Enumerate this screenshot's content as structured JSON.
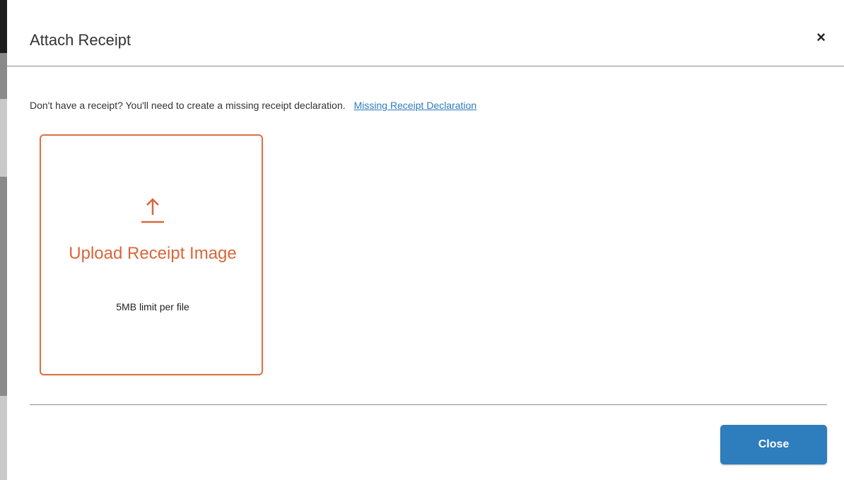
{
  "modal": {
    "title": "Attach Receipt",
    "close_icon_glyph": "×"
  },
  "notice": {
    "text": "Don't have a receipt? You'll need to create a missing receipt declaration.",
    "link_label": "Missing Receipt Declaration"
  },
  "upload": {
    "icon": "upload-arrow-icon",
    "title": "Upload Receipt Image",
    "limit_text": "5MB limit per file"
  },
  "footer": {
    "close_label": "Close"
  },
  "colors": {
    "accent_orange": "#d9663a",
    "primary_blue": "#2e7dbd",
    "link_blue": "#2f7bbf"
  }
}
